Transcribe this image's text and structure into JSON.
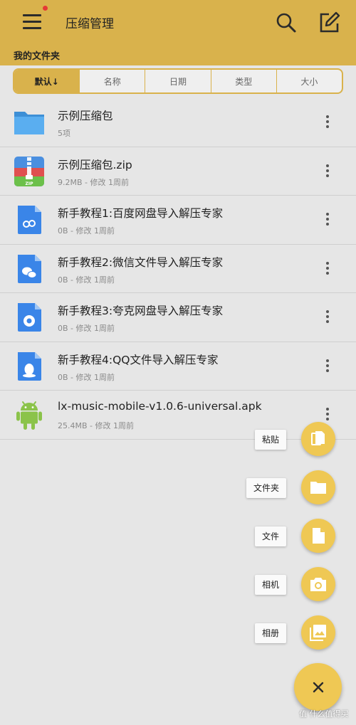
{
  "appbar": {
    "title": "压缩管理",
    "menu_icon": "menu-icon",
    "search_icon": "search-icon",
    "edit_icon": "edit-icon",
    "accent_color": "#d9b24c"
  },
  "folder_label": "我的文件夹",
  "sort_tabs": [
    {
      "label": "默认↓",
      "selected": true
    },
    {
      "label": "名称",
      "selected": false
    },
    {
      "label": "日期",
      "selected": false
    },
    {
      "label": "类型",
      "selected": false
    },
    {
      "label": "大小",
      "selected": false
    }
  ],
  "files": [
    {
      "name": "示例压缩包",
      "meta": "5项",
      "icon": "folder-icon"
    },
    {
      "name": "示例压缩包.zip",
      "meta": "9.2MB - 修改 1周前",
      "icon": "zip-icon"
    },
    {
      "name": "新手教程1:百度网盘导入解压专家",
      "meta": "0B - 修改 1周前",
      "icon": "baidu-doc-icon"
    },
    {
      "name": "新手教程2:微信文件导入解压专家",
      "meta": "0B - 修改 1周前",
      "icon": "wechat-doc-icon"
    },
    {
      "name": "新手教程3:夸克网盘导入解压专家",
      "meta": "0B - 修改 1周前",
      "icon": "quark-doc-icon"
    },
    {
      "name": "新手教程4:QQ文件导入解压专家",
      "meta": "0B - 修改 1周前",
      "icon": "qq-doc-icon"
    },
    {
      "name": "lx-music-mobile-v1.0.6-universal.apk",
      "meta": "25.4MB - 修改 1周前",
      "icon": "android-icon"
    }
  ],
  "fab_actions": [
    {
      "label": "粘贴",
      "icon": "paste-icon"
    },
    {
      "label": "文件夹",
      "icon": "folder-icon"
    },
    {
      "label": "文件",
      "icon": "file-icon"
    },
    {
      "label": "相机",
      "icon": "camera-icon"
    },
    {
      "label": "相册",
      "icon": "gallery-icon"
    }
  ],
  "fab_main_icon": "close-icon",
  "watermark": "值 什么值得买"
}
